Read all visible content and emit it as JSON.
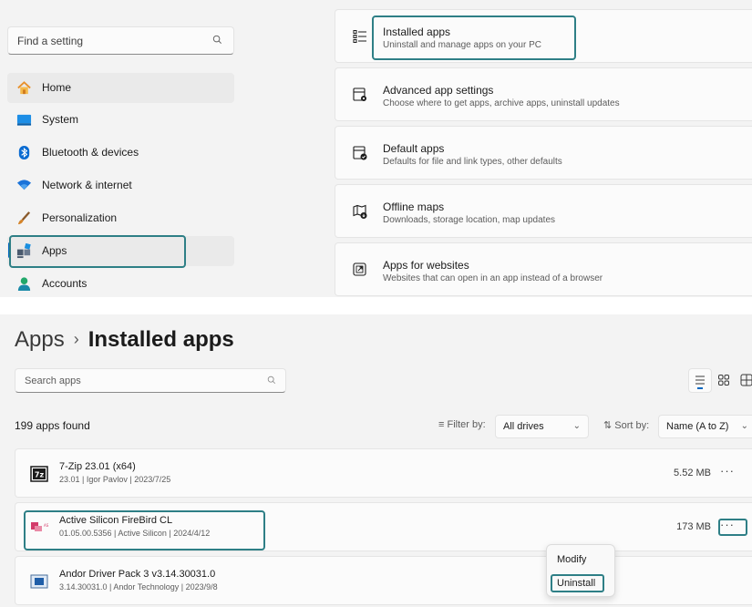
{
  "settings_nav": {
    "search_placeholder": "Find a setting",
    "items": [
      {
        "label": "Home",
        "icon": "home-icon"
      },
      {
        "label": "System",
        "icon": "system-icon"
      },
      {
        "label": "Bluetooth & devices",
        "icon": "bluetooth-icon"
      },
      {
        "label": "Network & internet",
        "icon": "wifi-icon"
      },
      {
        "label": "Personalization",
        "icon": "brush-icon"
      },
      {
        "label": "Apps",
        "icon": "apps-icon",
        "selected": true
      },
      {
        "label": "Accounts",
        "icon": "account-icon"
      }
    ]
  },
  "apps_settings": [
    {
      "title": "Installed apps",
      "description": "Uninstall and manage apps on your PC",
      "icon": "list-icon"
    },
    {
      "title": "Advanced app settings",
      "description": "Choose where to get apps, archive apps, uninstall updates",
      "icon": "app-gear-icon"
    },
    {
      "title": "Default apps",
      "description": "Defaults for file and link types, other defaults",
      "icon": "default-apps-icon"
    },
    {
      "title": "Offline maps",
      "description": "Downloads, storage location, map updates",
      "icon": "map-icon"
    },
    {
      "title": "Apps for websites",
      "description": "Websites that can open in an app instead of a browser",
      "icon": "open-link-icon"
    }
  ],
  "installed_apps": {
    "breadcrumb_parent": "Apps",
    "breadcrumb_separator": "›",
    "breadcrumb_current": "Installed apps",
    "search_placeholder": "Search apps",
    "count_text": "199 apps found",
    "filter_label": "Filter by:",
    "filter_value": "All drives",
    "sort_label": "Sort by:",
    "sort_value": "Name (A to Z)",
    "apps": [
      {
        "name": "7-Zip 23.01 (x64)",
        "meta": "23.01  |  Igor Pavlov  |  2023/7/25",
        "size": "5.52 MB",
        "icon": "7zip-icon"
      },
      {
        "name": "Active Silicon FireBird CL",
        "meta": "01.05.00.5356  |  Active Silicon  |  2024/4/12",
        "size": "173 MB",
        "icon": "active-silicon-icon"
      },
      {
        "name": "Andor Driver Pack 3 v3.14.30031.0",
        "meta": "3.14.30031.0  |  Andor Technology  |  2023/9/8",
        "size": "",
        "icon": "andor-icon"
      }
    ],
    "more_label": "···",
    "context_menu": [
      "Modify",
      "Uninstall"
    ]
  },
  "colors": {
    "highlight": "#2e7f86",
    "accent": "#0067c0",
    "panel_bg": "#f3f3f3"
  }
}
